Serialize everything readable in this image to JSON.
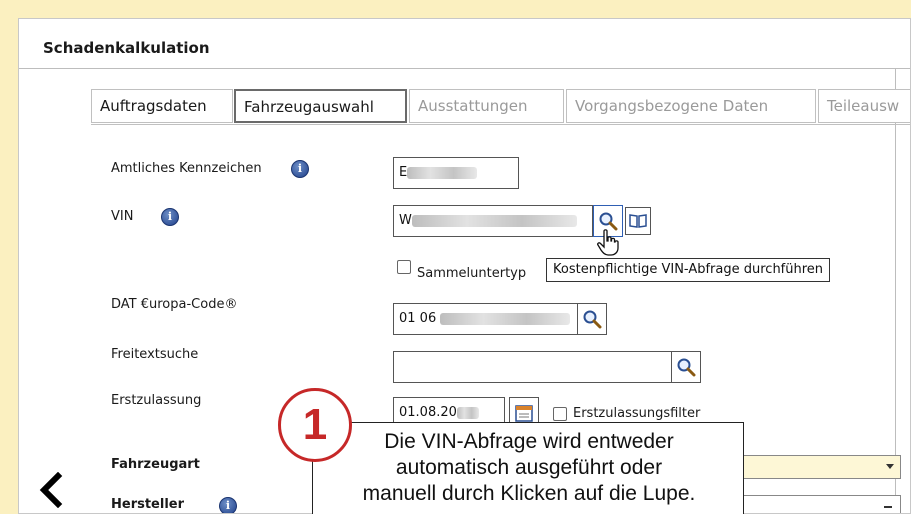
{
  "window": {
    "title": "Schadenkalkulation"
  },
  "tabs": [
    {
      "label": "Auftragsdaten",
      "state": "normal"
    },
    {
      "label": "Fahrzeugauswahl",
      "state": "active"
    },
    {
      "label": "Ausstattungen",
      "state": "disabled"
    },
    {
      "label": "Vorgangsbezogene Daten",
      "state": "disabled"
    },
    {
      "label": "Teileausw",
      "state": "disabled"
    }
  ],
  "form": {
    "kennzeichen": {
      "label": "Amtliches Kennzeichen",
      "value": "E"
    },
    "vin": {
      "label": "VIN",
      "value": "W"
    },
    "sammeluntertyp": {
      "label": "Sammeluntertyp",
      "checked": false
    },
    "tooltip": "Kostenpflichtige VIN-Abfrage durchführen",
    "dat_code": {
      "label": "DAT €uropa-Code®",
      "value": "01 06"
    },
    "freitext": {
      "label": "Freitextsuche",
      "value": ""
    },
    "erstzulassung": {
      "label": "Erstzulassung",
      "value": "01.08.20"
    },
    "erstzulassungsfilter": {
      "label": "Erstzulassungsfilter",
      "checked": false
    },
    "fahrzeugart": {
      "label": "Fahrzeugart"
    },
    "hersteller": {
      "label": "Hersteller"
    }
  },
  "icons": {
    "info": "i",
    "search": "magnifier-icon",
    "book": "book-icon",
    "calendar": "calendar-icon",
    "back": "‹"
  },
  "callout": {
    "number": "1",
    "lines": [
      "Die VIN-Abfrage wird entweder",
      "automatisch ausgeführt oder",
      "manuell durch Klicken auf die Lupe."
    ]
  },
  "colors": {
    "badge": "#c62828",
    "frame": "#fbf0c0"
  }
}
